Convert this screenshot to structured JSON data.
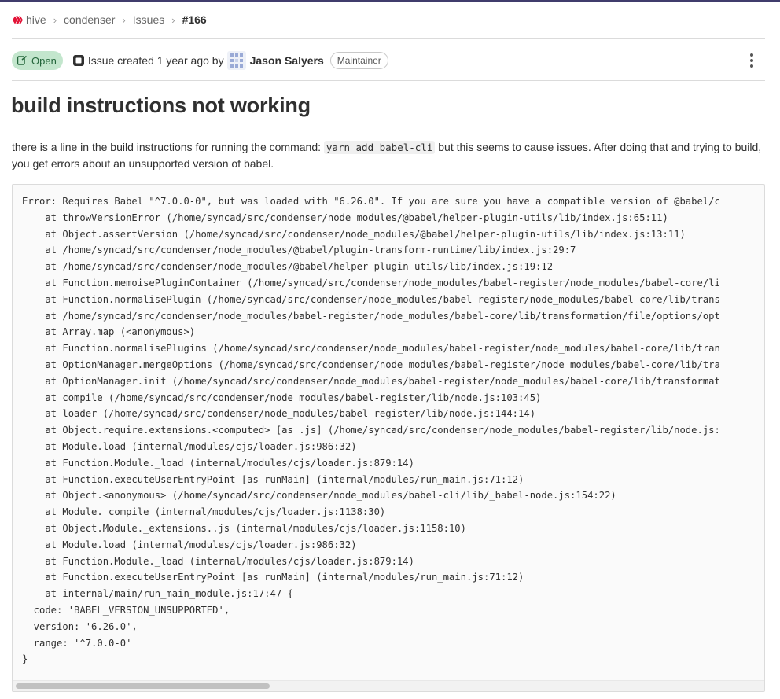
{
  "breadcrumb": {
    "items": [
      "hive",
      "condenser",
      "Issues",
      "#166"
    ]
  },
  "issue": {
    "status": "Open",
    "meta_prefix": "Issue created 1 year ago by",
    "author": "Jason Salyers",
    "role": "Maintainer",
    "title": "build instructions not working",
    "description": {
      "part1": "there is a line in the build instructions for running the command: ",
      "code": "yarn add babel-cli",
      "part2": " but this seems to cause issues. After doing that and trying to build, you get errors about an unsupported version of babel."
    }
  },
  "code_block": {
    "lines": [
      "Error: Requires Babel \"^7.0.0-0\", but was loaded with \"6.26.0\". If you are sure you have a compatible version of @babel/c",
      "    at throwVersionError (/home/syncad/src/condenser/node_modules/@babel/helper-plugin-utils/lib/index.js:65:11)",
      "    at Object.assertVersion (/home/syncad/src/condenser/node_modules/@babel/helper-plugin-utils/lib/index.js:13:11)",
      "    at /home/syncad/src/condenser/node_modules/@babel/plugin-transform-runtime/lib/index.js:29:7",
      "    at /home/syncad/src/condenser/node_modules/@babel/helper-plugin-utils/lib/index.js:19:12",
      "    at Function.memoisePluginContainer (/home/syncad/src/condenser/node_modules/babel-register/node_modules/babel-core/li",
      "    at Function.normalisePlugin (/home/syncad/src/condenser/node_modules/babel-register/node_modules/babel-core/lib/trans",
      "    at /home/syncad/src/condenser/node_modules/babel-register/node_modules/babel-core/lib/transformation/file/options/opt",
      "    at Array.map (<anonymous>)",
      "    at Function.normalisePlugins (/home/syncad/src/condenser/node_modules/babel-register/node_modules/babel-core/lib/tran",
      "    at OptionManager.mergeOptions (/home/syncad/src/condenser/node_modules/babel-register/node_modules/babel-core/lib/tra",
      "    at OptionManager.init (/home/syncad/src/condenser/node_modules/babel-register/node_modules/babel-core/lib/transformat",
      "    at compile (/home/syncad/src/condenser/node_modules/babel-register/lib/node.js:103:45)",
      "    at loader (/home/syncad/src/condenser/node_modules/babel-register/lib/node.js:144:14)",
      "    at Object.require.extensions.<computed> [as .js] (/home/syncad/src/condenser/node_modules/babel-register/lib/node.js:",
      "    at Module.load (internal/modules/cjs/loader.js:986:32)",
      "    at Function.Module._load (internal/modules/cjs/loader.js:879:14)",
      "    at Function.executeUserEntryPoint [as runMain] (internal/modules/run_main.js:71:12)",
      "    at Object.<anonymous> (/home/syncad/src/condenser/node_modules/babel-cli/lib/_babel-node.js:154:22)",
      "    at Module._compile (internal/modules/cjs/loader.js:1138:30)",
      "    at Object.Module._extensions..js (internal/modules/cjs/loader.js:1158:10)",
      "    at Module.load (internal/modules/cjs/loader.js:986:32)",
      "    at Function.Module._load (internal/modules/cjs/loader.js:879:14)",
      "    at Function.executeUserEntryPoint [as runMain] (internal/modules/run_main.js:71:12)",
      "    at internal/main/run_main_module.js:17:47 {",
      "  code: 'BABEL_VERSION_UNSUPPORTED',",
      "  version: '6.26.0',",
      "  range: '^7.0.0-0'",
      "}"
    ]
  },
  "icons": {
    "breadcrumb_logo": "hive-logo",
    "status": "issue-open-icon",
    "issue_type": "issue-type-icon",
    "avatar": "identicon-avatar",
    "menu": "more-actions-kebab-icon"
  },
  "colors": {
    "accent_topline": "#403c6c",
    "hive_red": "#e31337",
    "status_bg": "#c3e6cd",
    "status_text": "#24663b"
  }
}
